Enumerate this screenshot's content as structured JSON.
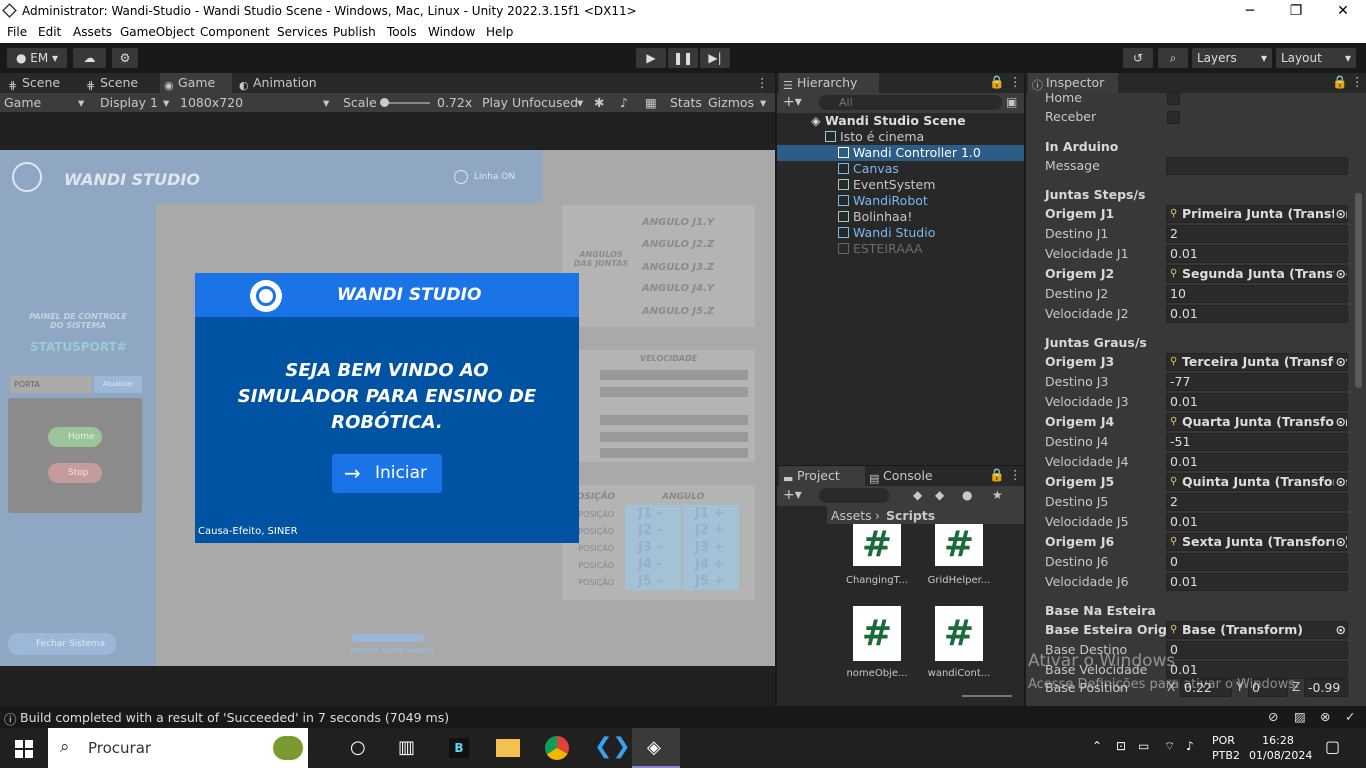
{
  "window": {
    "title": "Administrator: Wandi-Studio - Wandi Studio Scene - Windows, Mac, Linux - Unity 2022.3.15f1 <DX11>",
    "min": "─",
    "max": "❐",
    "close": "✕"
  },
  "menu": [
    "File",
    "Edit",
    "Assets",
    "GameObject",
    "Component",
    "Services",
    "Publish",
    "Tools",
    "Window",
    "Help"
  ],
  "toolbar": {
    "account": "EM",
    "layers": "Layers",
    "layout": "Layout"
  },
  "tabs": {
    "scene1": "Scene",
    "scene2": "Scene",
    "game": "Game",
    "animation": "Animation"
  },
  "gamebar": {
    "mode": "Game",
    "display": "Display 1",
    "resolution": "1080x720",
    "scale_label": "Scale",
    "scale_value": "0.72x",
    "play_mode": "Play Unfocused",
    "stats": "Stats",
    "gizmos": "Gizmos"
  },
  "game": {
    "brand": "WANDI STUDIO",
    "linha": "Linha ON",
    "painel": "PAINEL DE CONTROLE DO SISTEMA",
    "statusport": "STATUSPORT#",
    "porta": "PORTA",
    "atualizar": "Atualizar",
    "home": "Home",
    "stop": "Stop",
    "fechar": "Fechar Sistema",
    "object_name": "OBJECT NAME WANDI",
    "angulos_label": "ANGULOS DAS JUNTAS",
    "angulos": [
      "ANGULO J1.Y",
      "ANGULO J2.Z",
      "ANGULO J3.Z",
      "ANGULO J4.Y",
      "ANGULO J5.Z"
    ],
    "velocidade": "VELOCIDADE",
    "posicao": "POSIÇÃO",
    "angulo": "ANGULO",
    "pos_rows": [
      "POSIÇÃO",
      "POSIÇÃO",
      "POSIÇÃO",
      "POSIÇÃO",
      "POSIÇÃO"
    ],
    "jminus": [
      "J1 -",
      "J2 -",
      "J3 -",
      "J4 -",
      "J5 -"
    ],
    "jplus": [
      "J1 +",
      "J2 +",
      "J3 +",
      "J4 +",
      "J5 +"
    ],
    "modal_title": "WANDI STUDIO",
    "modal_text": "SEJA BEM VINDO AO SIMULADOR PARA ENSINO DE ROBÓTICA.",
    "modal_button": "Iniciar",
    "modal_footer": "Causa-Efeito, SINER"
  },
  "hierarchy": {
    "title": "Hierarchy",
    "search": "All",
    "scene": "Wandi Studio Scene",
    "items": [
      "Isto é cinema",
      "Wandi Controller 1.0",
      "Canvas",
      "EventSystem",
      "WandiRobot",
      "Bolinhaa!",
      "Wandi Studio",
      "ESTEIRAAA"
    ]
  },
  "project": {
    "tab": "Project",
    "console": "Console",
    "path_root": "Assets",
    "path_leaf": "Scripts",
    "files": [
      "ChangingT...",
      "GridHelper...",
      "nomeObje...",
      "wandiCont..."
    ]
  },
  "inspector": {
    "title": "Inspector",
    "rows": [
      {
        "label": "Home",
        "type": "check"
      },
      {
        "label": "Receber",
        "type": "check"
      },
      {
        "label": "In Arduino",
        "type": "header"
      },
      {
        "label": "Message",
        "type": "text",
        "value": ""
      },
      {
        "label": "Juntas Steps/s",
        "type": "header"
      },
      {
        "label": "Origem J1",
        "type": "obj",
        "value": "Primeira Junta (Transform)"
      },
      {
        "label": "Destino J1",
        "type": "text",
        "value": "2"
      },
      {
        "label": "Velocidade J1",
        "type": "text",
        "value": "0.01"
      },
      {
        "label": "Origem J2",
        "type": "obj",
        "value": "Segunda Junta (Transform)"
      },
      {
        "label": "Destino J2",
        "type": "text",
        "value": "10"
      },
      {
        "label": "Velocidade J2",
        "type": "text",
        "value": "0.01"
      },
      {
        "label": "Juntas Graus/s",
        "type": "header"
      },
      {
        "label": "Origem J3",
        "type": "obj",
        "value": "Terceira Junta (Transform)"
      },
      {
        "label": "Destino J3",
        "type": "text",
        "value": "-77"
      },
      {
        "label": "Velocidade J3",
        "type": "text",
        "value": "0.01"
      },
      {
        "label": "Origem J4",
        "type": "obj",
        "value": "Quarta Junta (Transform)"
      },
      {
        "label": "Destino J4",
        "type": "text",
        "value": "-51"
      },
      {
        "label": "Velocidade J4",
        "type": "text",
        "value": "0.01"
      },
      {
        "label": "Origem J5",
        "type": "obj",
        "value": "Quinta Junta (Transform)"
      },
      {
        "label": "Destino J5",
        "type": "text",
        "value": "2"
      },
      {
        "label": "Velocidade J5",
        "type": "text",
        "value": "0.01"
      },
      {
        "label": "Origem J6",
        "type": "obj",
        "value": "Sexta Junta (Transform)"
      },
      {
        "label": "Destino J6",
        "type": "text",
        "value": "0"
      },
      {
        "label": "Velocidade J6",
        "type": "text",
        "value": "0.01"
      },
      {
        "label": "Base Na Esteira",
        "type": "header"
      },
      {
        "label": "Base Esteira Origem",
        "type": "obj",
        "value": "Base (Transform)"
      },
      {
        "label": "Base Destino",
        "type": "text",
        "value": "0"
      },
      {
        "label": "Base Velocidade",
        "type": "text",
        "value": "0.01"
      }
    ],
    "pos_label": "Base Position",
    "x": "0.22",
    "y": "0",
    "z": "-0.99",
    "watermark1": "Ativar o Windows",
    "watermark2": "Acesse Definições para ativar o Windows."
  },
  "status": "Build completed with a result of 'Succeeded' in 7 seconds (7049 ms)",
  "taskbar": {
    "search": "Procurar",
    "lang1": "POR",
    "lang2": "PTB2",
    "time": "16:28",
    "date": "01/08/2024"
  }
}
